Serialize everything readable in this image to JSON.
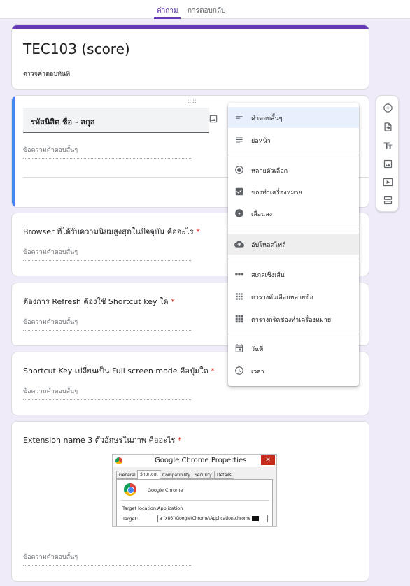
{
  "tabs": [
    {
      "label": "คำถาม",
      "active": true
    },
    {
      "label": "การตอบกลับ",
      "active": false
    }
  ],
  "form": {
    "title": "TEC103 (score)",
    "description": "ตรวจคำตอบทันที"
  },
  "active_question": {
    "title": "รหัสนิสิต ชื่อ - สกุล",
    "placeholder": "ข้อความคำตอบสั้นๆ"
  },
  "questions": [
    {
      "title": "Browser ที่ได้รับความนิยมสูงสุดในปัจจุบัน คืออะไร",
      "required_mark": "*",
      "placeholder": "ข้อความคำตอบสั้นๆ"
    },
    {
      "title": "ต้องการ Refresh ต้องใช้ Shortcut key ใด",
      "required_mark": "*",
      "placeholder": "ข้อความคำตอบสั้นๆ"
    },
    {
      "title": "Shortcut Key เปลี่ยนเป็น Full screen mode คือปุ่มใด",
      "required_mark": "*",
      "placeholder": "ข้อความคำตอบสั้นๆ"
    },
    {
      "title": "Extension name 3 ตัวอักษรในภาพ คืออะไร",
      "required_mark": "*",
      "placeholder": "ข้อความคำตอบสั้นๆ"
    }
  ],
  "dialog_image": {
    "title": "Google Chrome Properties",
    "close": "✕",
    "tabs": [
      "General",
      "Shortcut",
      "Compatibility",
      "Security",
      "Details"
    ],
    "app_name": "Google Chrome",
    "target_location_label": "Target location:",
    "target_location_value": "Application",
    "target_label": "Target:",
    "target_value": "a (x86)\\Google\\Chrome\\Application\\chrome"
  },
  "question_type_menu": {
    "items": [
      {
        "label": "คำตอบสั้นๆ",
        "icon": "short-answer-icon"
      },
      {
        "label": "ย่อหน้า",
        "icon": "paragraph-icon"
      },
      {
        "label": "หลายตัวเลือก",
        "icon": "radio-icon"
      },
      {
        "label": "ช่องทำเครื่องหมาย",
        "icon": "checkbox-icon"
      },
      {
        "label": "เลื่อนลง",
        "icon": "dropdown-icon"
      },
      {
        "label": "อัปโหลดไฟล์",
        "icon": "cloud-upload-icon"
      },
      {
        "label": "สเกลเชิงเส้น",
        "icon": "linear-scale-icon"
      },
      {
        "label": "ตารางตัวเลือกหลายข้อ",
        "icon": "grid-icon"
      },
      {
        "label": "ตารางกริดช่องทำเครื่องหมาย",
        "icon": "checkbox-grid-icon"
      },
      {
        "label": "วันที่",
        "icon": "calendar-icon"
      },
      {
        "label": "เวลา",
        "icon": "clock-icon"
      }
    ]
  },
  "toolbar": {
    "tools": [
      "add-question-icon",
      "import-questions-icon",
      "add-title-icon",
      "add-image-icon",
      "add-video-icon",
      "add-section-icon"
    ]
  },
  "colors": {
    "accent": "#673ab7",
    "active_border": "#4285f4",
    "background": "#f0ebf8",
    "required": "#d93025"
  }
}
